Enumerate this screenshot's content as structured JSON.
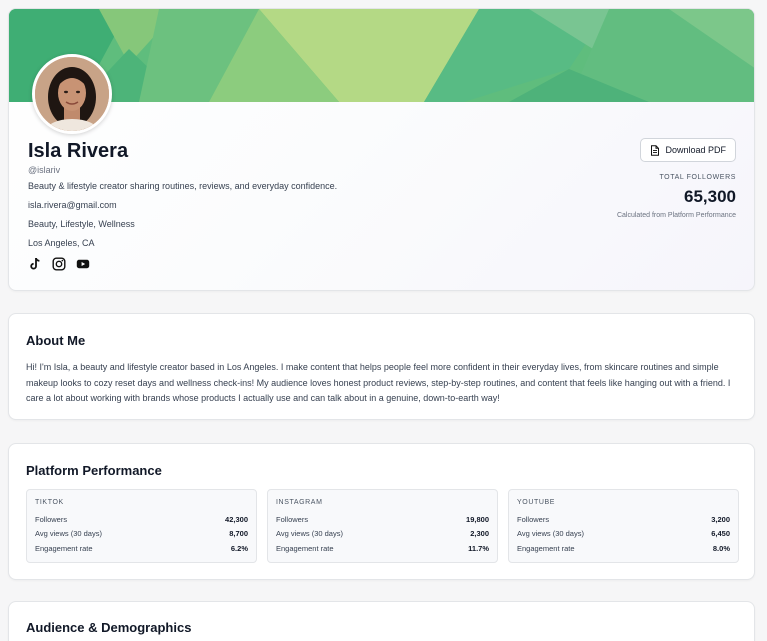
{
  "profile": {
    "name": "Isla Rivera",
    "handle": "@islariv",
    "bio": "Beauty & lifestyle creator sharing routines, reviews, and everyday confidence.",
    "email": "isla.rivera@gmail.com",
    "categories": "Beauty, Lifestyle, Wellness",
    "location": "Los Angeles, CA",
    "socials": [
      "tiktok-icon",
      "instagram-icon",
      "youtube-icon"
    ],
    "download_label": "Download PDF",
    "total_followers_label": "TOTAL FOLLOWERS",
    "total_followers_value": "65,300",
    "total_followers_note": "Calculated from Platform Performance"
  },
  "about": {
    "title": "About Me",
    "text": "Hi! I'm Isla, a beauty and lifestyle creator based in Los Angeles. I make content that helps people feel more confident in their everyday lives, from skincare routines and simple makeup looks to cozy reset days and wellness check-ins! My audience loves honest product reviews, step-by-step routines, and content that feels like hanging out with a friend. I care a lot about working with brands whose products I actually use and can talk about in a genuine, down-to-earth way!"
  },
  "platform": {
    "title": "Platform Performance",
    "cards": [
      {
        "name": "TIKTOK",
        "rows": [
          {
            "label": "Followers",
            "value": "42,300"
          },
          {
            "label": "Avg views (30 days)",
            "value": "8,700"
          },
          {
            "label": "Engagement rate",
            "value": "6.2%"
          }
        ]
      },
      {
        "name": "INSTAGRAM",
        "rows": [
          {
            "label": "Followers",
            "value": "19,800"
          },
          {
            "label": "Avg views (30 days)",
            "value": "2,300"
          },
          {
            "label": "Engagement rate",
            "value": "11.7%"
          }
        ]
      },
      {
        "name": "YOUTUBE",
        "rows": [
          {
            "label": "Followers",
            "value": "3,200"
          },
          {
            "label": "Avg views (30 days)",
            "value": "6,450"
          },
          {
            "label": "Engagement rate",
            "value": "8.0%"
          }
        ]
      }
    ]
  },
  "audience": {
    "title": "Audience & Demographics"
  },
  "colors": {
    "banner_dark": "#3fae74",
    "banner_mid": "#6cc17f",
    "banner_light": "#b4d985",
    "text_dark": "#111827"
  }
}
